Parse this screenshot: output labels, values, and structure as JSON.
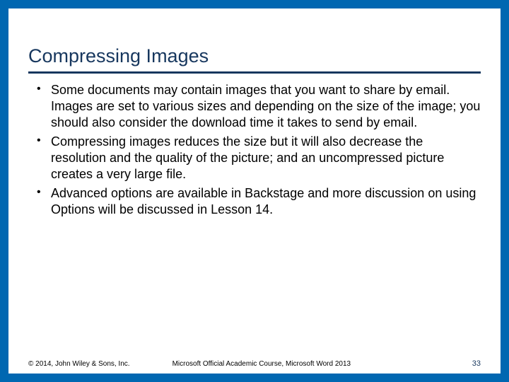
{
  "colors": {
    "frame": "#0067b1",
    "heading": "#17375e",
    "text": "#000000"
  },
  "title": "Compressing Images",
  "bullets": [
    "Some documents may contain images that you want to share by email. Images are set to various sizes and depending on the size of the image; you should also consider the download time it takes to send by email.",
    "Compressing images reduces the size but it will also decrease the resolution and the quality of the picture; and an uncompressed picture creates a very large file.",
    "Advanced options are available in Backstage and more discussion on using Options will be discussed in Lesson 14."
  ],
  "footer": {
    "copyright": "© 2014, John Wiley & Sons, Inc.",
    "course": "Microsoft Official Academic Course, Microsoft Word 2013",
    "page": "33"
  }
}
